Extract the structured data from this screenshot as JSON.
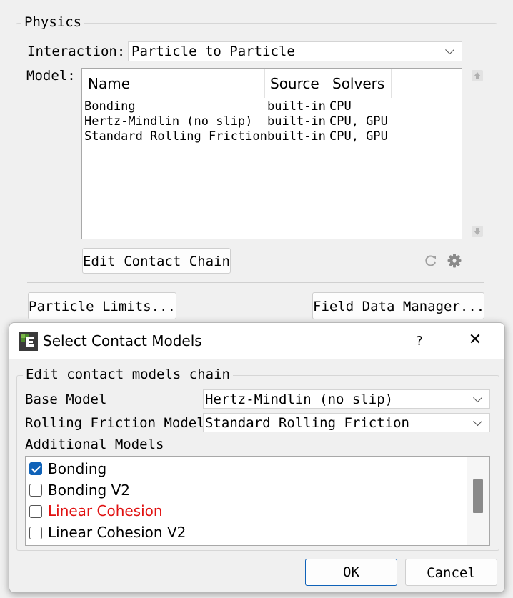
{
  "physics": {
    "group_title": "Physics",
    "interaction_label": "Interaction:",
    "interaction_value": "Particle to Particle",
    "model_label": "Model:",
    "table": {
      "columns": [
        "Name",
        "Source",
        "Solvers"
      ],
      "rows": [
        {
          "name": "Bonding",
          "source": "built-in",
          "solvers": "CPU"
        },
        {
          "name": "Hertz-Mindlin (no slip)",
          "source": "built-in",
          "solvers": "CPU, GPU"
        },
        {
          "name": "Standard Rolling Friction",
          "source": "built-in",
          "solvers": "CPU, GPU"
        }
      ]
    },
    "edit_chain_button": "Edit Contact Chain",
    "particle_limits_button": "Particle Limits...",
    "field_data_button": "Field Data Manager..."
  },
  "dialog": {
    "title": "Select Contact Models",
    "help_label": "?",
    "close_label": "✕",
    "group_title": "Edit contact models chain",
    "base_model_label": "Base Model",
    "base_model_value": "Hertz-Mindlin (no slip)",
    "rolling_label": "Rolling Friction Model",
    "rolling_value": "Standard Rolling Friction",
    "additional_label": "Additional Models",
    "additional": [
      {
        "label": "Bonding",
        "checked": true,
        "color": "#000000"
      },
      {
        "label": "Bonding V2",
        "checked": false,
        "color": "#000000"
      },
      {
        "label": "Linear Cohesion",
        "checked": false,
        "color": "#e01010"
      },
      {
        "label": "Linear Cohesion V2",
        "checked": false,
        "color": "#000000"
      }
    ],
    "ok_label": "OK",
    "cancel_label": "Cancel"
  },
  "colors": {
    "accent": "#0f62b8",
    "warning_text": "#e01010"
  }
}
